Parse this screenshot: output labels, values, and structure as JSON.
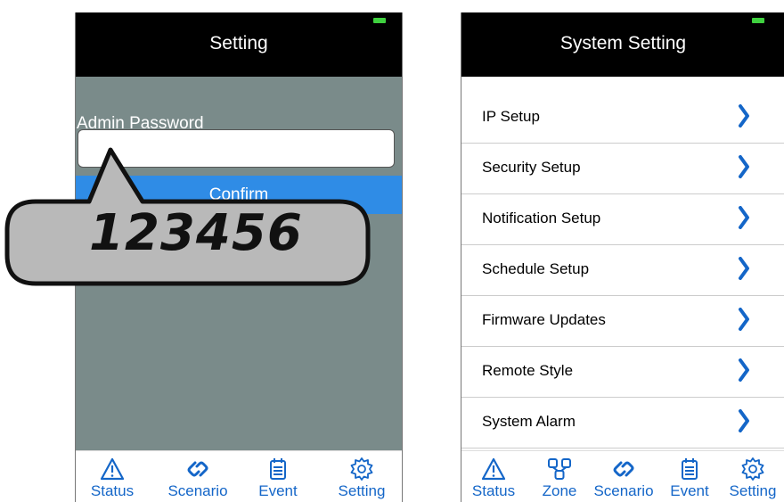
{
  "left_screen": {
    "title": "Setting",
    "password_label": "Admin Password",
    "password_value": "",
    "confirm_label": "Confirm",
    "tabs": [
      {
        "label": "Status",
        "icon": "warning-triangle-icon"
      },
      {
        "label": "Scenario",
        "icon": "link-icon"
      },
      {
        "label": "Event",
        "icon": "calendar-list-icon"
      },
      {
        "label": "Setting",
        "icon": "gear-icon"
      }
    ]
  },
  "callout": {
    "text": "123456"
  },
  "right_screen": {
    "title": "System Setting",
    "menu_items": [
      {
        "label": "IP Setup"
      },
      {
        "label": "Security Setup"
      },
      {
        "label": "Notification Setup"
      },
      {
        "label": "Schedule Setup"
      },
      {
        "label": "Firmware Updates"
      },
      {
        "label": "Remote Style"
      },
      {
        "label": "System Alarm"
      }
    ],
    "tabs": [
      {
        "label": "Status",
        "icon": "warning-triangle-icon"
      },
      {
        "label": "Zone",
        "icon": "zone-nodes-icon"
      },
      {
        "label": "Scenario",
        "icon": "link-icon"
      },
      {
        "label": "Event",
        "icon": "calendar-list-icon"
      },
      {
        "label": "Setting",
        "icon": "gear-icon"
      }
    ]
  },
  "colors": {
    "header_bg": "#000000",
    "gray_panel": "#7a8b8a",
    "accent_blue": "#2f8ce6",
    "tab_blue": "#1466c8",
    "battery_green": "#3fd13f"
  }
}
